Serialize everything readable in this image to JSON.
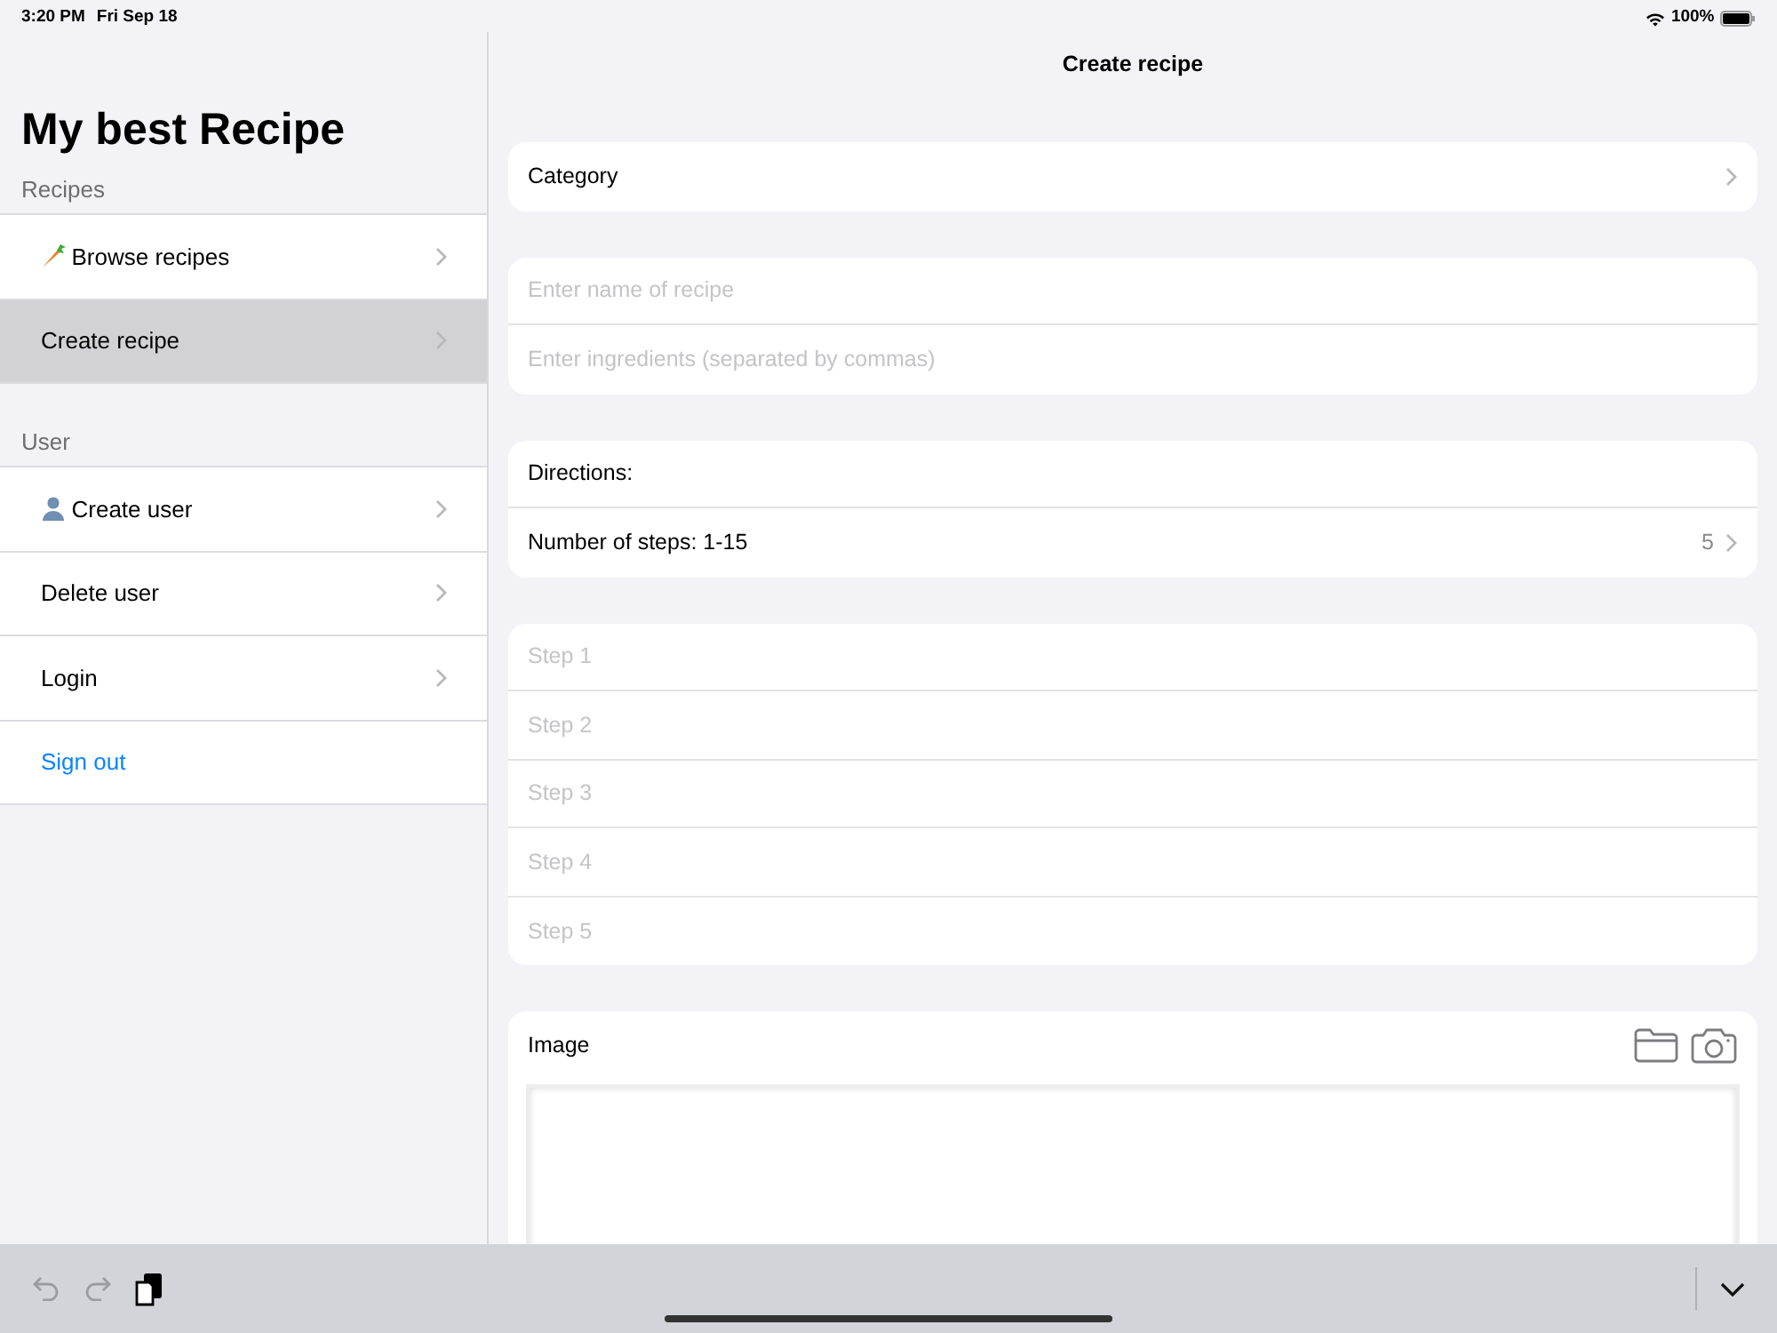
{
  "status_bar": {
    "time": "3:20 PM",
    "date": "Fri Sep 18",
    "battery": "100%"
  },
  "sidebar": {
    "title": "My best Recipe",
    "sections": [
      {
        "header": "Recipes",
        "items": [
          {
            "label": "Browse recipes",
            "kind": "carrot",
            "selected": false
          },
          {
            "label": "Create recipe",
            "kind": "plain",
            "selected": true
          }
        ]
      },
      {
        "header": "User",
        "items": [
          {
            "label": "Create user",
            "kind": "person",
            "selected": false
          },
          {
            "label": "Delete user",
            "kind": "plain",
            "selected": false
          },
          {
            "label": "Login",
            "kind": "plain",
            "selected": false
          },
          {
            "label": "Sign out",
            "kind": "link",
            "selected": false
          }
        ]
      }
    ]
  },
  "main": {
    "title": "Create recipe",
    "category": {
      "label": "Category"
    },
    "fields": [
      {
        "placeholder": "Enter name of recipe"
      },
      {
        "placeholder": "Enter ingredients (separated by commas)"
      }
    ],
    "directions": {
      "label": "Directions:",
      "steps_label": "Number of steps: 1-15",
      "steps_value": "5"
    },
    "steps": [
      {
        "placeholder": "Step 1"
      },
      {
        "placeholder": "Step 2"
      },
      {
        "placeholder": "Step 3"
      },
      {
        "placeholder": "Step 4"
      },
      {
        "placeholder": "Step 5"
      }
    ],
    "image": {
      "label": "Image"
    }
  }
}
